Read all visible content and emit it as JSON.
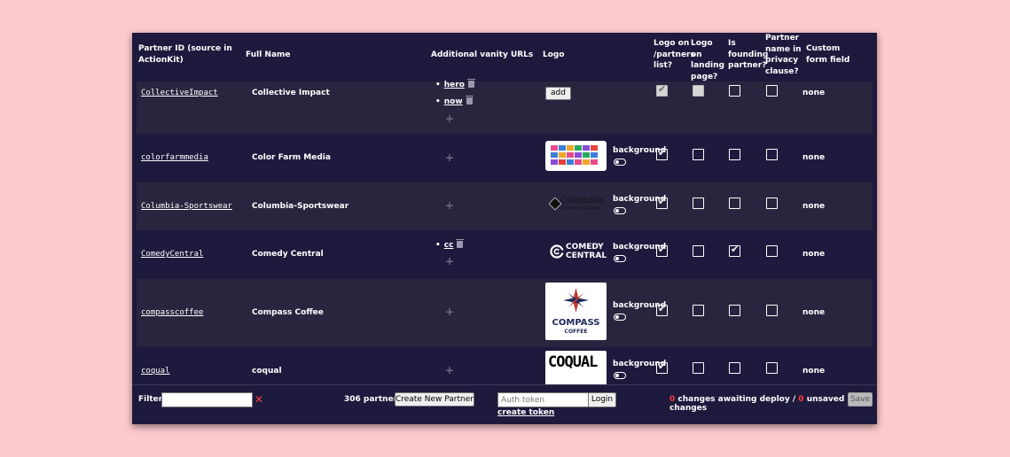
{
  "headers": {
    "partner_id": "Partner ID (source in ActionKit)",
    "full_name": "Full Name",
    "vanity": "Additional vanity URLs",
    "logo": "Logo",
    "logo_partners": "Logo on /partners list?",
    "logo_landing": "Logo on landing page?",
    "founding": "Is founding partner?",
    "privacy": "Partner name in privacy clause?",
    "custom_field": "Custom form field"
  },
  "rows": [
    {
      "id": "CollectiveImpact",
      "name": "Collective Impact",
      "vanity": [
        "hero",
        "now"
      ],
      "logo": "add",
      "custom": "none"
    },
    {
      "id": "colorfarmmedia",
      "name": "Color Farm Media",
      "background": "background",
      "custom": "none"
    },
    {
      "id": "Columbia-Sportswear",
      "name": "Columbia-Sportswear",
      "background": "background",
      "custom": "none",
      "logo_text": "Columbia",
      "logo_sub": "Sportswear Company"
    },
    {
      "id": "ComedyCentral",
      "name": "Comedy Central",
      "vanity": [
        "cc"
      ],
      "background": "background",
      "custom": "none",
      "logo_text": "COMEDY",
      "logo_text2": "CENTRAL"
    },
    {
      "id": "compasscoffee",
      "name": "Compass Coffee",
      "background": "background",
      "custom": "none",
      "logo_text": "COMPASS",
      "logo_sub": "COFFEE"
    },
    {
      "id": "coqual",
      "name": "coqual",
      "background": "background",
      "custom": "none",
      "logo_text": "COQUAL"
    }
  ],
  "footer": {
    "filter_label": "Filter:",
    "clear": "✕",
    "partners_count": "306 partners",
    "create_button": "Create New Partner",
    "auth_placeholder": "Auth token",
    "login_button": "Login",
    "create_token": "create token",
    "changes_count": "0",
    "changes_text": "changes awaiting deploy /",
    "unsaved_count": "0",
    "unsaved_text": "unsaved changes",
    "save_button": "Save"
  },
  "plus": "+",
  "check": "✔",
  "bullet": "•",
  "colors": {
    "panel": "#1d1a3d",
    "row_alt": "#29253f",
    "page_bg": "#fcc9cc",
    "accent_red": "#ff3b3b"
  }
}
